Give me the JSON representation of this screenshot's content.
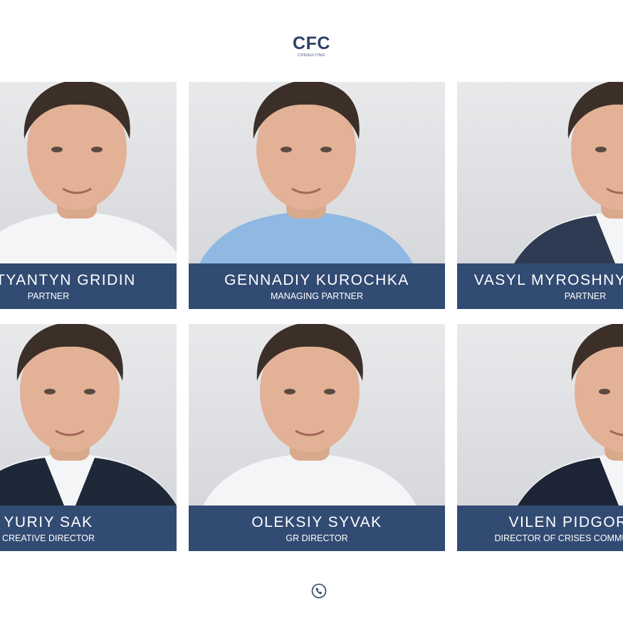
{
  "header": {
    "logo_text": "CFC",
    "logo_subtext": "CONSULTING"
  },
  "team": {
    "members": [
      {
        "name": "KOSTYANTYN GRIDIN",
        "role": "PARTNER",
        "shirt_color": "#f4f5f7",
        "jacket_color": ""
      },
      {
        "name": "GENNADIY KUROCHKA",
        "role": "MANAGING PARTNER",
        "shirt_color": "#8fb8e3",
        "jacket_color": ""
      },
      {
        "name": "VASYL MYROSHNYCHENKO",
        "role": "PARTNER",
        "shirt_color": "#f4f5f7",
        "jacket_color": "#2f3b52"
      },
      {
        "name": "YURIY SAK",
        "role": "CREATIVE DIRECTOR",
        "shirt_color": "#f4f5f7",
        "jacket_color": "#1f2838"
      },
      {
        "name": "OLEKSIY SYVAK",
        "role": "GR DIRECTOR",
        "shirt_color": "#f4f5f7",
        "jacket_color": ""
      },
      {
        "name": "VILEN PIDGORNYY",
        "role": "DIRECTOR OF CRISES COMMUNICATIONS",
        "shirt_color": "#f4f5f7",
        "jacket_color": "#1c2436"
      }
    ]
  },
  "footer": {
    "icon": "phone-icon"
  },
  "colors": {
    "brand": "#2e4266",
    "plate": "#324b73",
    "background": "#ffffff"
  }
}
